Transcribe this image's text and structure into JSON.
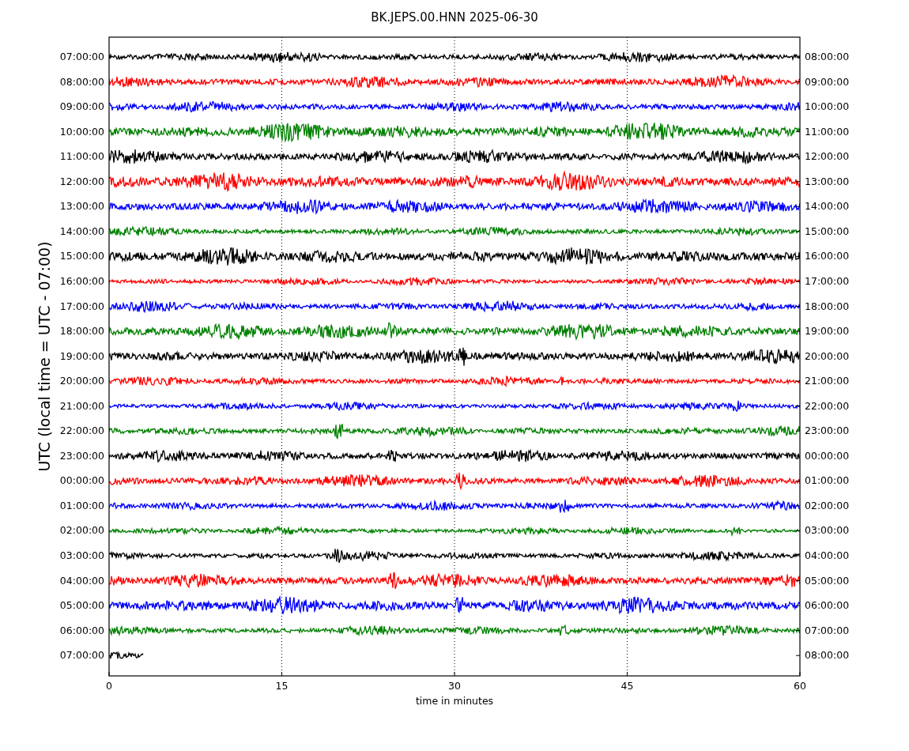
{
  "title": "BK.JEPS.00.HNN 2025-06-30",
  "ylabel": "UTC (local time = UTC - 07:00)",
  "xlabel": "time in minutes",
  "xticks": [
    "0",
    "15",
    "30",
    "45",
    "60"
  ],
  "traces": [
    {
      "left": "07:00:00",
      "right": "08:00:00",
      "color": "#000000",
      "level": 1
    },
    {
      "left": "08:00:00",
      "right": "09:00:00",
      "color": "#ff0000",
      "level": 1
    },
    {
      "left": "09:00:00",
      "right": "10:00:00",
      "color": "#0000ff",
      "level": 1
    },
    {
      "left": "10:00:00",
      "right": "11:00:00",
      "color": "#008000",
      "level": 1
    },
    {
      "left": "11:00:00",
      "right": "12:00:00",
      "color": "#000000",
      "level": 1
    },
    {
      "left": "12:00:00",
      "right": "13:00:00",
      "color": "#ff0000",
      "level": 1
    },
    {
      "left": "13:00:00",
      "right": "14:00:00",
      "color": "#0000ff",
      "level": 1
    },
    {
      "left": "14:00:00",
      "right": "15:00:00",
      "color": "#008000",
      "level": 1
    },
    {
      "left": "15:00:00",
      "right": "16:00:00",
      "color": "#000000",
      "level": 1
    },
    {
      "left": "16:00:00",
      "right": "17:00:00",
      "color": "#ff0000",
      "level": 1
    },
    {
      "left": "17:00:00",
      "right": "18:00:00",
      "color": "#0000ff",
      "level": 1
    },
    {
      "left": "18:00:00",
      "right": "19:00:00",
      "color": "#008000",
      "level": 1
    },
    {
      "left": "19:00:00",
      "right": "20:00:00",
      "color": "#000000",
      "level": 1
    },
    {
      "left": "20:00:00",
      "right": "21:00:00",
      "color": "#ff0000",
      "level": 1
    },
    {
      "left": "21:00:00",
      "right": "22:00:00",
      "color": "#0000ff",
      "level": 1
    },
    {
      "left": "22:00:00",
      "right": "23:00:00",
      "color": "#008000",
      "level": 1
    },
    {
      "left": "23:00:00",
      "right": "00:00:00",
      "color": "#000000",
      "level": 1
    },
    {
      "left": "00:00:00",
      "right": "01:00:00",
      "color": "#ff0000",
      "level": 1
    },
    {
      "left": "01:00:00",
      "right": "02:00:00",
      "color": "#0000ff",
      "level": 1
    },
    {
      "left": "02:00:00",
      "right": "03:00:00",
      "color": "#008000",
      "level": 1
    },
    {
      "left": "03:00:00",
      "right": "04:00:00",
      "color": "#000000",
      "level": 1
    },
    {
      "left": "04:00:00",
      "right": "05:00:00",
      "color": "#ff0000",
      "level": 1
    },
    {
      "left": "05:00:00",
      "right": "06:00:00",
      "color": "#0000ff",
      "level": 1
    },
    {
      "left": "06:00:00",
      "right": "07:00:00",
      "color": "#008000",
      "level": 1
    },
    {
      "left": "07:00:00",
      "right": "08:00:00",
      "color": "#000000",
      "level": 0.05
    }
  ]
}
